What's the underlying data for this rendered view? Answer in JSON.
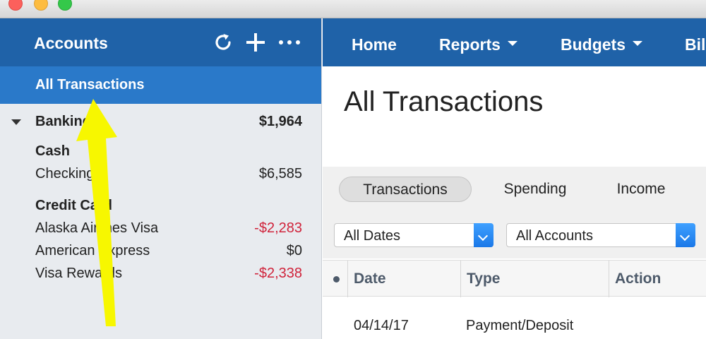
{
  "window": {
    "controls": [
      "close",
      "minimize",
      "maximize"
    ]
  },
  "sidebar": {
    "title": "Accounts",
    "icons": [
      "refresh-icon",
      "plus-icon",
      "more-icon"
    ],
    "selected": "All Transactions",
    "banking": {
      "label": "Banking",
      "amount": "$1,964"
    },
    "cash": {
      "header": "Cash",
      "accounts": [
        {
          "label": "Checking",
          "amount": "$6,585"
        }
      ]
    },
    "credit": {
      "header": "Credit Card",
      "accounts": [
        {
          "label": "Alaska Airlines Visa",
          "amount": "-$2,283"
        },
        {
          "label": "American Express",
          "amount": "$0"
        },
        {
          "label": "Visa Rewards",
          "amount": "-$2,338"
        }
      ]
    }
  },
  "nav": {
    "items": [
      "Home",
      "Reports",
      "Budgets",
      "Bill"
    ]
  },
  "main": {
    "title": "All Transactions",
    "tabs": [
      "Transactions",
      "Spending",
      "Income"
    ],
    "filters": {
      "dates": "All Dates",
      "accounts": "All Accounts"
    },
    "columns": [
      "Date",
      "Type",
      "Action"
    ],
    "rows": [
      {
        "date": "04/14/17",
        "type": "Payment/Deposit"
      }
    ]
  },
  "colors": {
    "header_blue": "#1f62a8",
    "selected_blue": "#2a79c9",
    "negative": "#d0233b",
    "annotation_arrow": "#f7f700"
  }
}
